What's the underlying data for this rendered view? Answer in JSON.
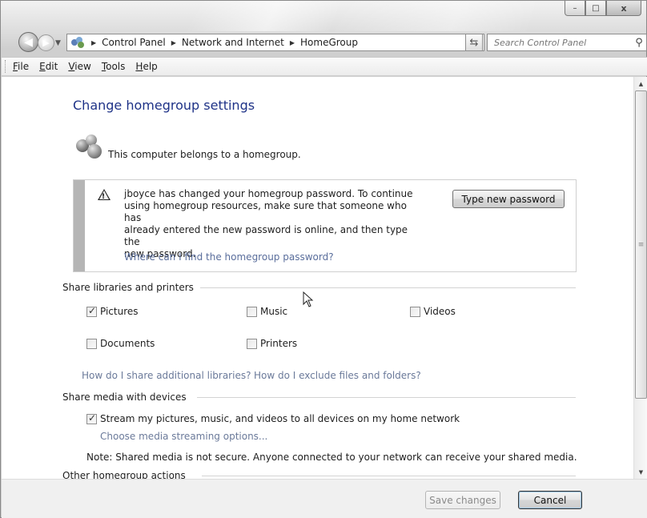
{
  "window": {
    "minimize_label": "–",
    "maximize_label": "□",
    "close_label": "x"
  },
  "nav": {
    "back_glyph": "◀",
    "forward_glyph": "▶",
    "breadcrumbs": [
      "Control Panel",
      "Network and Internet",
      "HomeGroup"
    ],
    "search_placeholder": "Search Control Panel"
  },
  "menu": {
    "items": [
      {
        "label": "File",
        "u": "F",
        "rest": "ile"
      },
      {
        "label": "Edit",
        "u": "E",
        "rest": "dit"
      },
      {
        "label": "View",
        "u": "V",
        "rest": "iew"
      },
      {
        "label": "Tools",
        "u": "T",
        "rest": "ools"
      },
      {
        "label": "Help",
        "u": "H",
        "rest": "elp"
      }
    ]
  },
  "page": {
    "title": "Change homegroup settings",
    "status": "This computer belongs to a homegroup."
  },
  "warning": {
    "lines": [
      "jboyce has changed your homegroup password. To continue",
      "using homegroup resources, make sure that someone who has",
      "already entered the new password is online, and then type the",
      "new password."
    ],
    "link": "Where can I find the homegroup password?",
    "button": "Type new password"
  },
  "share_libraries": {
    "header": "Share libraries and printers",
    "items": [
      {
        "label": "Pictures",
        "checked": true
      },
      {
        "label": "Music",
        "checked": false
      },
      {
        "label": "Videos",
        "checked": false
      },
      {
        "label": "Documents",
        "checked": false
      },
      {
        "label": "Printers",
        "checked": false
      }
    ],
    "link_additional": "How do I share additional libraries?",
    "link_exclude": "How do I exclude files and folders?"
  },
  "share_media": {
    "header": "Share media with devices",
    "stream_label": "Stream my pictures, music, and videos to all devices on my home network",
    "stream_checked": true,
    "options_link": "Choose media streaming options...",
    "note": "Note: Shared media is not secure. Anyone connected to your network can receive your shared media."
  },
  "other_actions": {
    "header": "Other homegroup actions"
  },
  "footer": {
    "save_label": "Save changes",
    "cancel_label": "Cancel"
  }
}
